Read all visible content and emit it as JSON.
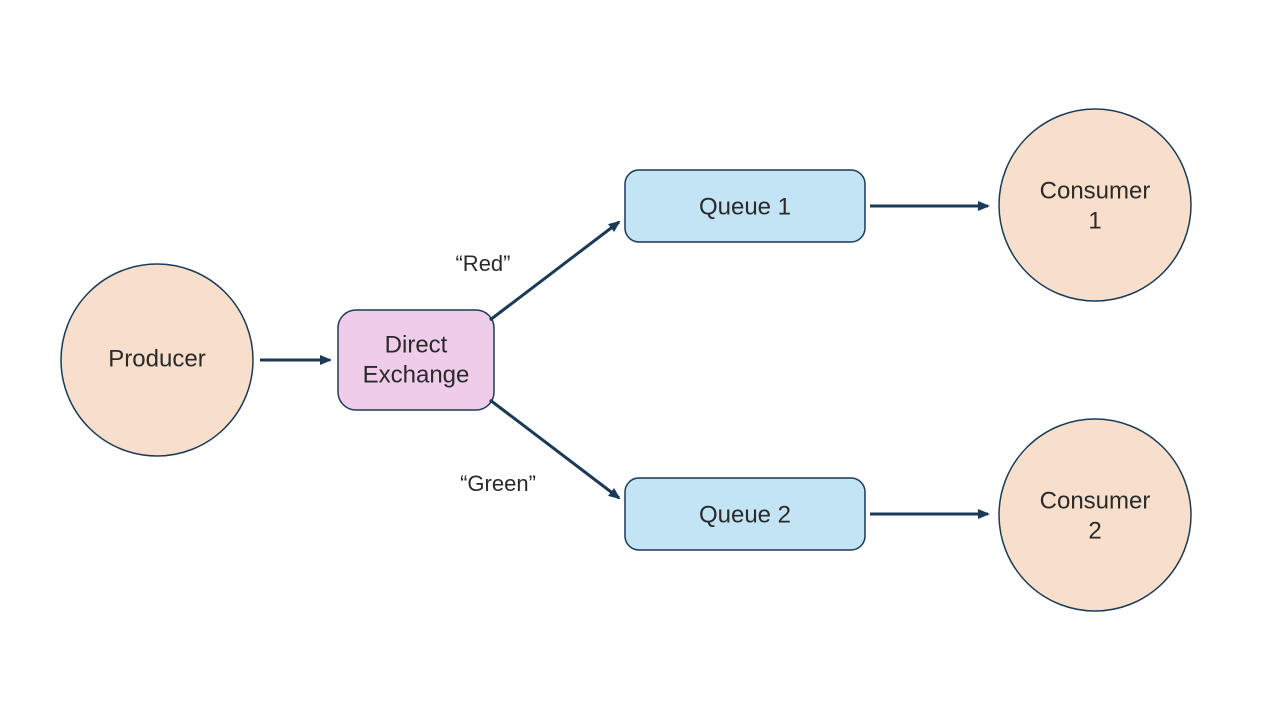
{
  "nodes": {
    "producer": {
      "label": "Producer"
    },
    "exchange": {
      "line1": "Direct",
      "line2": "Exchange"
    },
    "queue1": {
      "label": "Queue 1"
    },
    "queue2": {
      "label": "Queue 2"
    },
    "consumer1": {
      "line1": "Consumer",
      "line2": "1"
    },
    "consumer2": {
      "line1": "Consumer",
      "line2": "2"
    }
  },
  "edges": {
    "red": {
      "label": "“Red”"
    },
    "green": {
      "label": "“Green”"
    }
  },
  "colors": {
    "peach": "#f8dfcc",
    "pink": "#efccea",
    "blue": "#c2e4f4",
    "stroke": "#1b3a57"
  }
}
